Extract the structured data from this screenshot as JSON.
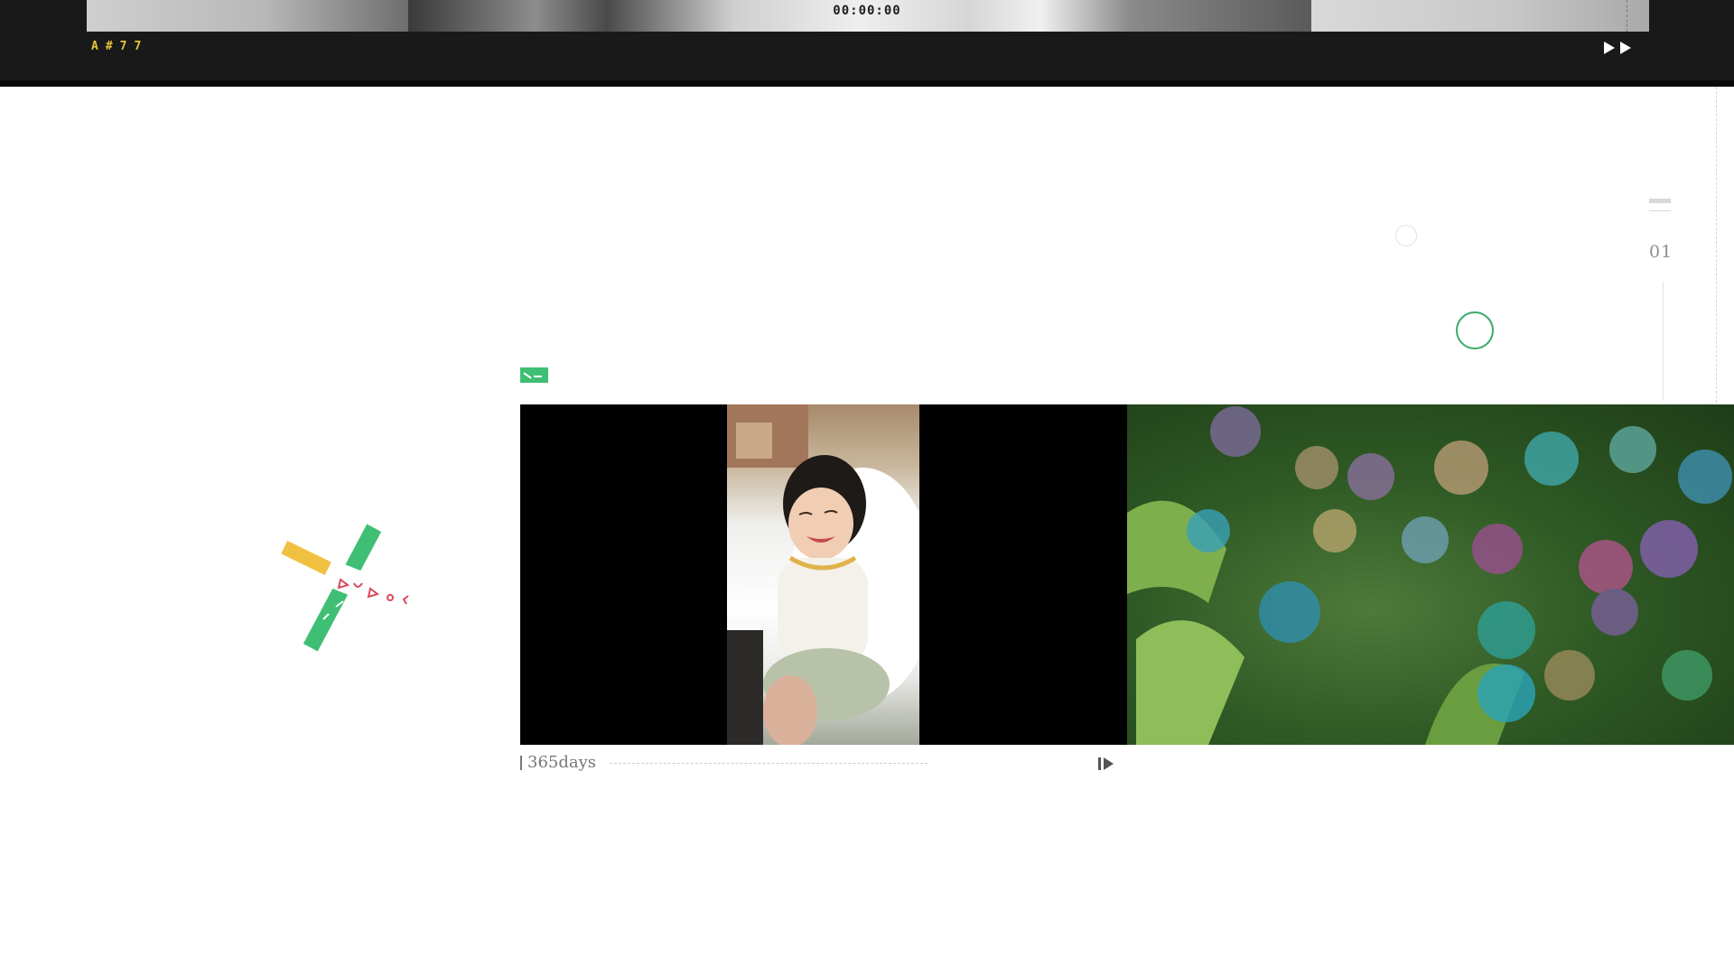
{
  "player": {
    "timecode": "00:00:00",
    "frame_code": "A#77",
    "forward_icon": "fast-forward-icon"
  },
  "slide": {
    "number": "01"
  },
  "video": {
    "caption": "365days",
    "play_icon": "play-icon"
  },
  "colors": {
    "accent_green": "#3fbf74",
    "accent_yellow": "#f0c040",
    "frame_code_yellow": "#e9c43c",
    "dark_bar": "#191919"
  }
}
